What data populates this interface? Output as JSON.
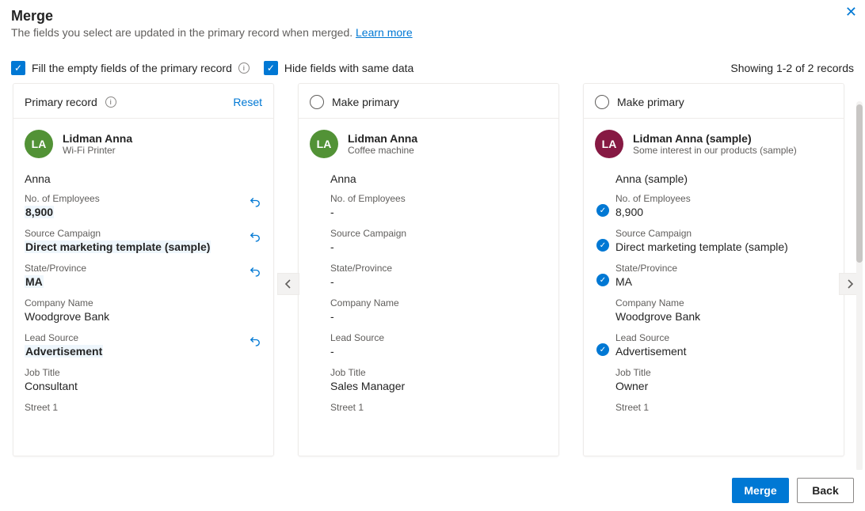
{
  "header": {
    "title": "Merge",
    "subtitle_prefix": "The fields you select are updated in the primary record when merged. ",
    "learn_more": "Learn more"
  },
  "options": {
    "fill_empty_label": "Fill the empty fields of the primary record",
    "hide_same_label": "Hide fields with same data"
  },
  "showing": "Showing 1-2 of 2 records",
  "labels": {
    "primary_record": "Primary record",
    "reset": "Reset",
    "make_primary": "Make primary",
    "no_employees": "No. of Employees",
    "source_campaign": "Source Campaign",
    "state": "State/Province",
    "company": "Company Name",
    "lead_source": "Lead Source",
    "job_title": "Job Title",
    "street1": "Street 1"
  },
  "records": [
    {
      "is_primary": true,
      "avatar_initials": "LA",
      "avatar_color": "green",
      "name": "Lidman Anna",
      "subtitle": "Wi-Fi Printer",
      "topic": "Anna",
      "fields": {
        "no_employees": {
          "value": "8,900",
          "highlight": true,
          "undo": true
        },
        "source_campaign": {
          "value": "Direct marketing template (sample)",
          "highlight": true,
          "undo": true
        },
        "state": {
          "value": "MA",
          "highlight": true,
          "undo": true
        },
        "company": {
          "value": "Woodgrove Bank"
        },
        "lead_source": {
          "value": "Advertisement",
          "highlight": true,
          "undo": true
        },
        "job_title": {
          "value": "Consultant"
        },
        "street1": {
          "value": ""
        }
      }
    },
    {
      "is_primary": false,
      "avatar_initials": "LA",
      "avatar_color": "green",
      "name": "Lidman Anna",
      "subtitle": "Coffee machine",
      "topic": "Anna",
      "fields": {
        "no_employees": {
          "value": "-"
        },
        "source_campaign": {
          "value": "-"
        },
        "state": {
          "value": "-"
        },
        "company": {
          "value": "-"
        },
        "lead_source": {
          "value": "-"
        },
        "job_title": {
          "value": "Sales Manager"
        },
        "street1": {
          "value": ""
        }
      }
    },
    {
      "is_primary": false,
      "avatar_initials": "LA",
      "avatar_color": "maroon",
      "name": "Lidman Anna (sample)",
      "subtitle": "Some interest in our products (sample)",
      "topic": "Anna (sample)",
      "fields": {
        "no_employees": {
          "value": "8,900",
          "selected": true
        },
        "source_campaign": {
          "value": "Direct marketing template (sample)",
          "selected": true
        },
        "state": {
          "value": "MA",
          "selected": true
        },
        "company": {
          "value": "Woodgrove Bank"
        },
        "lead_source": {
          "value": "Advertisement",
          "selected": true
        },
        "job_title": {
          "value": "Owner"
        },
        "street1": {
          "value": ""
        }
      }
    }
  ],
  "footer": {
    "merge": "Merge",
    "back": "Back"
  }
}
